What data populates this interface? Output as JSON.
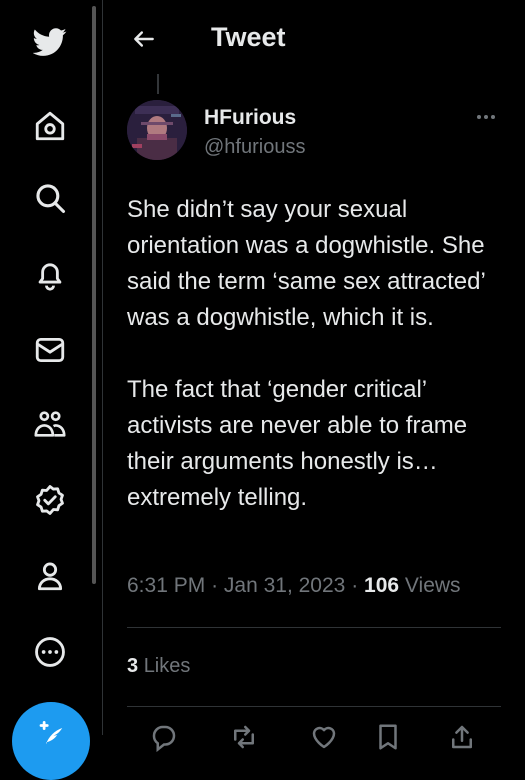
{
  "nav": {
    "items": [
      {
        "icon": "twitter-bird-icon"
      },
      {
        "icon": "home-icon"
      },
      {
        "icon": "search-icon"
      },
      {
        "icon": "bell-icon"
      },
      {
        "icon": "mail-icon"
      },
      {
        "icon": "communities-icon"
      },
      {
        "icon": "verified-icon"
      },
      {
        "icon": "profile-icon"
      },
      {
        "icon": "more-circle-icon"
      }
    ],
    "compose_icon": "compose-icon"
  },
  "header": {
    "title": "Tweet",
    "back_icon": "arrow-left-icon"
  },
  "tweet": {
    "display_name": "HFurious",
    "handle": "@hfuriouss",
    "text": "She didn’t say your sexual orientation was a dogwhistle. She said the term ‘same sex attracted’ was a dogwhistle, which it is.\n\nThe fact that ‘gender critical’ activists are never able to frame their arguments honestly is… extremely telling.",
    "time": "6:31 PM",
    "dot": "·",
    "date": "Jan 31, 2023",
    "views_count": "106",
    "views_label": "Views",
    "likes_count": "3",
    "likes_label": "Likes"
  },
  "colors": {
    "background": "#000000",
    "text": "#e7e9ea",
    "muted": "#71767b",
    "accent": "#1d9bf0",
    "border": "#2f3336"
  }
}
